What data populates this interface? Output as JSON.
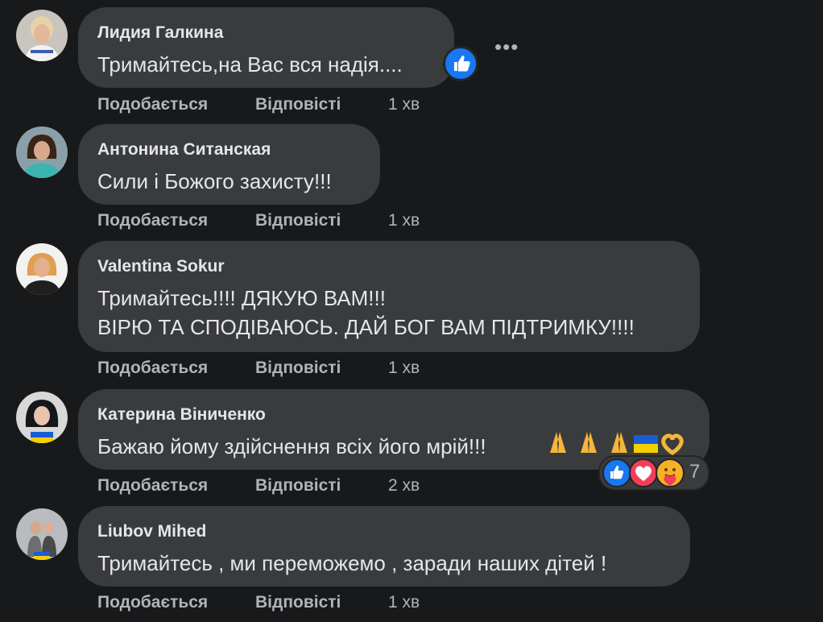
{
  "actions": {
    "like_label": "Подобається",
    "reply_label": "Відповісті"
  },
  "more_icon": "more-horizontal-icon",
  "comments": [
    {
      "author": "Лидия Галкина",
      "text": "Тримайтесь,на Вас вся надія....",
      "time": "1 хв",
      "reaction": "like"
    },
    {
      "author": "Антонина Ситанская",
      "text": "Сили і Божого захисту!!!",
      "time": "1 хв"
    },
    {
      "author": "Valentina Sokur",
      "text": "Тримайтесь!!!! ДЯКУЮ ВАМ!!!\nВІРЮ ТА СПОДІВАЮСЬ. ДАЙ БОГ ВАМ ПІДТРИМКУ!!!!",
      "time": "1 хв"
    },
    {
      "author": "Катерина Віниченко",
      "text": "Бажаю йому здійснення всіх його мрій!!!",
      "emojis": [
        "folded-hands",
        "folded-hands",
        "folded-hands",
        "ukraine-flag",
        "heart-hands"
      ],
      "time": "2 хв",
      "reactions": {
        "icons": [
          "like",
          "love",
          "care"
        ],
        "count": "7"
      }
    },
    {
      "author": "Liubov Mihed",
      "text": "Тримайтесь , ми переможемо , заради наших дітей !",
      "time": "1 хв"
    }
  ],
  "colors": {
    "background": "#18191a",
    "bubble": "#3a3b3c",
    "primary_text": "#e4e6eb",
    "secondary_text": "#b0b3b8",
    "like_blue": "#1877f2",
    "love_red": "#f33e58"
  }
}
